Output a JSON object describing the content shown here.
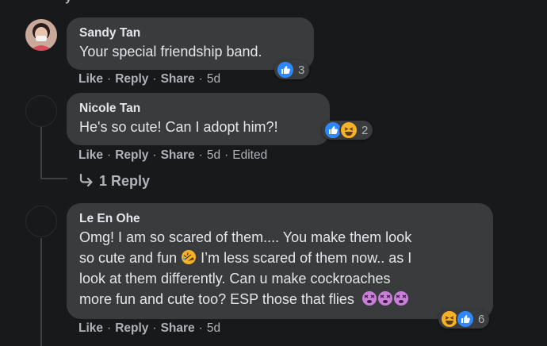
{
  "top_cut": "y",
  "comments": [
    {
      "author": "Sandy Tan",
      "text": "Your special friendship band.",
      "actions": {
        "like": "Like",
        "reply": "Reply",
        "share": "Share",
        "time": "5d"
      },
      "reactions": {
        "icons": [
          "like-icon"
        ],
        "count": "3"
      }
    },
    {
      "author": "Nicole Tan",
      "text": "He's so cute! Can I adopt him?!",
      "actions": {
        "like": "Like",
        "reply": "Reply",
        "share": "Share",
        "time": "5d",
        "edited": "Edited"
      },
      "reactions": {
        "icons": [
          "like-icon",
          "haha-icon"
        ],
        "count": "2"
      },
      "replies_link": "1 Reply"
    },
    {
      "author": "Le En Ohe",
      "text_lines": [
        "Omg! I am so scared of them.... You make them look",
        "so cute and fun",
        " I’m less scared of them now.. as I",
        "look at them differently. Can u make cockroaches",
        "more fun and cute too? ESP those that flies"
      ],
      "actions": {
        "like": "Like",
        "reply": "Reply",
        "share": "Share",
        "time": "5d"
      },
      "reactions": {
        "icons": [
          "haha-icon",
          "like-icon"
        ],
        "count": "6"
      }
    }
  ],
  "colors": {
    "background": "#18191a",
    "bubble": "#3a3b3c",
    "text": "#e4e6eb",
    "secondary": "#b0b3b8",
    "like_blue": "#2d88ff",
    "haha_yellow": "#f7b125"
  }
}
